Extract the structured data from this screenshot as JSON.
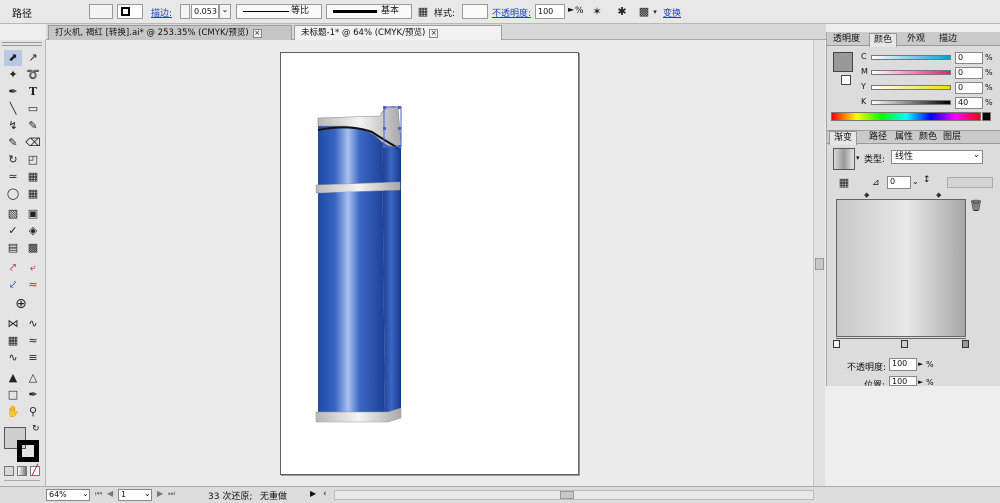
{
  "control_bar": {
    "object_type": "路径",
    "stroke_label": "描边:",
    "stroke_weight": "0.053",
    "profile_label": "等比",
    "brush_label": "基本",
    "style_label": "样式:",
    "opacity_label": "不透明度:",
    "opacity_value": "100",
    "percent": "%",
    "transform_label": "变换"
  },
  "document_tabs": [
    {
      "label": "打火机, 褐红 [转换].ai* @ 253.35% (CMYK/预览)",
      "active": false
    },
    {
      "label": "未标题-1* @ 64% (CMYK/预览)",
      "active": true
    }
  ],
  "color_panel": {
    "tabs": [
      "透明度",
      "颜色",
      "外观",
      "描边"
    ],
    "active_tab": "颜色",
    "channels": [
      {
        "name": "C",
        "value": "0"
      },
      {
        "name": "M",
        "value": "0"
      },
      {
        "name": "Y",
        "value": "0"
      },
      {
        "name": "K",
        "value": "40"
      }
    ],
    "fill_color": "#999999"
  },
  "gradient_panel": {
    "tabs": [
      "渐变",
      "路径",
      "属性",
      "颜色",
      "图层"
    ],
    "active_tab": "渐变",
    "type_label": "类型:",
    "type_value": "线性",
    "angle_value": "0",
    "opacity_label": "不透明度:",
    "opacity_value": "100",
    "location_label": "位置:",
    "location_value": "100",
    "percent": "%"
  },
  "status_bar": {
    "zoom": "64%",
    "page": "1",
    "undo_text": "33 次还原;",
    "redo_text": "无重做"
  },
  "colors": {
    "lighter_blue": "#2a5cb8",
    "lighter_blue_highlight": "#9ab6e8",
    "selection": "#4a62d8"
  }
}
